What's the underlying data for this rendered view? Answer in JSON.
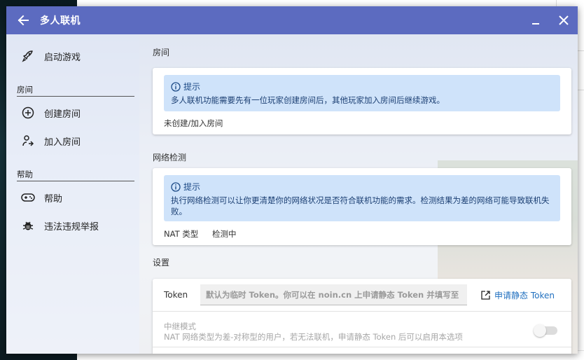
{
  "window": {
    "title": "多人联机"
  },
  "sidebar": {
    "items": [
      {
        "label": "启动游戏",
        "icon": "rocket-icon"
      },
      {
        "label": "创建房间",
        "icon": "plus-circle-icon"
      },
      {
        "label": "加入房间",
        "icon": "join-icon"
      },
      {
        "label": "帮助",
        "icon": "gamepad-icon"
      },
      {
        "label": "违法违规举报",
        "icon": "bug-icon"
      }
    ],
    "groups": [
      "房间",
      "帮助"
    ]
  },
  "room": {
    "section_label": "房间",
    "hint_title": "提示",
    "hint_text": "多人联机功能需要先有一位玩家创建房间后，其他玩家加入房间后继续游戏。",
    "status": "未创建/加入房间"
  },
  "network": {
    "section_label": "网络检测",
    "hint_title": "提示",
    "hint_text": "执行网络检测可以让你更清楚你的网络状况是否符合联机功能的需求。检测结果为差的网络可能导致联机失败。",
    "nat_label": "NAT 类型",
    "nat_value": "检测中"
  },
  "settings": {
    "section_label": "设置",
    "token_label": "Token",
    "token_placeholder": "默认为临时 Token。你可以在 noin.cn 上申请静态 Token 并填写至",
    "token_link": "申请静态 Token",
    "relay_title": "中继模式",
    "relay_desc": "NAT 网络类型为差-对称型的用户，若无法联机，申请静态 Token 后可以启用本选项",
    "relay_enabled": false
  }
}
